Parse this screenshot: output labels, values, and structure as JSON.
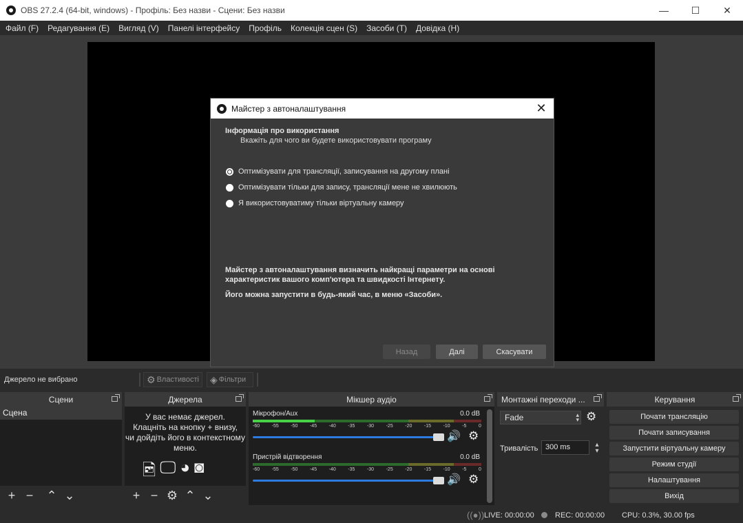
{
  "window": {
    "title": "OBS 27.2.4 (64-bit, windows) - Профіль: Без назви - Сцени: Без назви",
    "minimize": "—",
    "maximize": "☐",
    "close": "✕"
  },
  "menu": [
    "Файл (F)",
    "Редагування (E)",
    "Вигляд (V)",
    "Панелі інтерфейсу",
    "Профіль",
    "Колекція сцен (S)",
    "Засоби (T)",
    "Довідка (H)"
  ],
  "dialog": {
    "title": "Майстер з автоналаштування",
    "close": "✕",
    "section_title": "Інформація про використання",
    "section_subtitle": "Вкажіть для чого ви будете використовувати програму",
    "options": [
      {
        "label": "Оптимізувати для трансляції, записування на другому плані",
        "checked": true
      },
      {
        "label": "Оптимізувати тільки для запису, трансляції мене не хвилюють",
        "checked": false
      },
      {
        "label": "Я використовуватиму тільки віртуальну камеру",
        "checked": false
      }
    ],
    "info_1": "Майстер з автоналаштування визначить найкращі параметри на основі характеристик вашого комп'ютера та швидкості Інтернету.",
    "info_2": "Його можна запустити в будь-який час, в меню «Засоби».",
    "back": "Назад",
    "next": "Далі",
    "cancel": "Скасувати"
  },
  "source_toolbar": {
    "no_source": "Джерело не вибрано",
    "properties": "Властивості",
    "filters": "Фільтри"
  },
  "scenes": {
    "header": "Сцени",
    "items": [
      "Сцена"
    ]
  },
  "sources": {
    "header": "Джерела",
    "empty": "У вас немає джерел.\nКлацніть на кнопку + внизу,\nчи дойдіть його в контекстному\nменю."
  },
  "mixer": {
    "header": "Мікшер аудіо",
    "ticks": [
      "-60",
      "-55",
      "-50",
      "-45",
      "-40",
      "-35",
      "-30",
      "-25",
      "-20",
      "-15",
      "-10",
      "-5",
      "0"
    ],
    "channels": [
      {
        "name": "Мікрофон/Aux",
        "db": "0.0 dB",
        "level": 0.27
      },
      {
        "name": "Пристрій відтворення",
        "db": "0.0 dB",
        "level": 0
      }
    ]
  },
  "transitions": {
    "header": "Монтажні переходи ...",
    "selected": "Fade",
    "duration_label": "Тривалість",
    "duration_value": "300 ms"
  },
  "controls": {
    "header": "Керування",
    "buttons": [
      "Почати трансляцію",
      "Почати записування",
      "Запустити віртуальну камеру",
      "Режим студії",
      "Налаштування",
      "Вихід"
    ]
  },
  "status": {
    "live": "LIVE: 00:00:00",
    "rec": "REC: 00:00:00",
    "cpu": "CPU: 0.3%, 30.00 fps"
  }
}
